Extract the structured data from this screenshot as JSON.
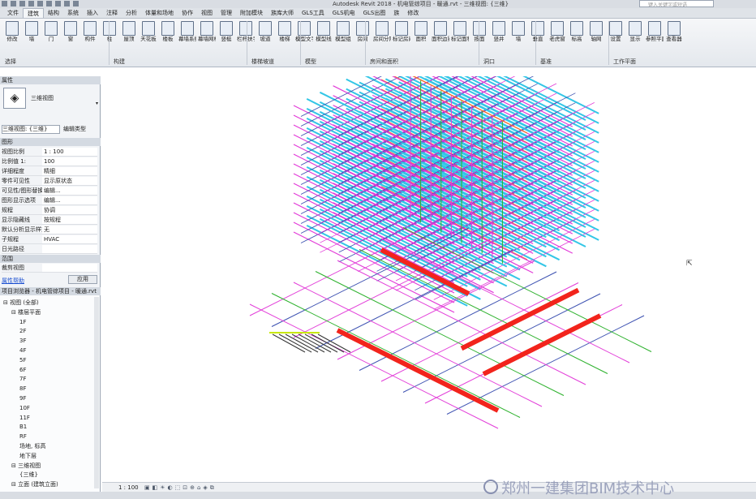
{
  "window": {
    "title": "Autodesk Revit 2018 -   机电管综项目 - 暖通.rvt - 三维视图: {三维}",
    "search_placeholder": "键入关键字或短语"
  },
  "tabs": [
    "文件",
    "建筑",
    "结构",
    "系统",
    "插入",
    "注释",
    "分析",
    "体量和场地",
    "协作",
    "视图",
    "管理",
    "附加模块",
    "族库大师",
    "GLS工具",
    "GLS机电",
    "GLS出图",
    "族",
    "修改"
  ],
  "active_tab": "建筑",
  "ribbon": {
    "tools": [
      "修改",
      "墙",
      "门",
      "窗",
      "构件",
      "柱",
      "屋顶",
      "天花板",
      "楼板",
      "幕墙系统",
      "幕墙网格",
      "竖梃",
      "栏杆扶手",
      "坡道",
      "楼梯",
      "模型文字",
      "模型线",
      "模型组",
      "房间",
      "房间分隔",
      "标记房间",
      "面积",
      "面积边界",
      "标记面积",
      "按面",
      "竖井",
      "墙",
      "垂直",
      "老虎窗",
      "标高",
      "轴网",
      "设置",
      "显示",
      "参照平面",
      "查看器"
    ],
    "panels": [
      "选择",
      "构建",
      "楼梯坡道",
      "模型",
      "房间和面积",
      "洞口",
      "基准",
      "工作平面"
    ]
  },
  "properties": {
    "header": "属性",
    "type_name": "三维视图",
    "selector": "三维视图: {三维}",
    "edit_type": "编辑类型",
    "section_graphics": "图形",
    "rows": [
      {
        "k": "视图比例",
        "v": "1 : 100"
      },
      {
        "k": "比例值 1:",
        "v": "100"
      },
      {
        "k": "详细程度",
        "v": "精细"
      },
      {
        "k": "零件可见性",
        "v": "显示原状态"
      },
      {
        "k": "可见性/图形替换",
        "v": "编辑..."
      },
      {
        "k": "图形显示选项",
        "v": "编辑..."
      },
      {
        "k": "规程",
        "v": "协调"
      },
      {
        "k": "显示隐藏线",
        "v": "按规程"
      },
      {
        "k": "默认分析显示样式",
        "v": "无"
      },
      {
        "k": "子规程",
        "v": "HVAC"
      },
      {
        "k": "日光路径",
        "v": ""
      }
    ],
    "section_extents": "范围",
    "crop_row": {
      "k": "裁剪视图",
      "v": ""
    },
    "help_link": "属性帮助",
    "apply": "应用"
  },
  "browser": {
    "header": "项目浏览器 - 机电管综项目 - 暖通.rvt",
    "items": [
      {
        "label": "视图 (全部)",
        "indent": 0
      },
      {
        "label": "楼层平面",
        "indent": 1
      },
      {
        "label": "1F",
        "indent": 2
      },
      {
        "label": "2F",
        "indent": 2
      },
      {
        "label": "3F",
        "indent": 2
      },
      {
        "label": "4F",
        "indent": 2
      },
      {
        "label": "5F",
        "indent": 2
      },
      {
        "label": "6F",
        "indent": 2
      },
      {
        "label": "7F",
        "indent": 2
      },
      {
        "label": "8F",
        "indent": 2
      },
      {
        "label": "9F",
        "indent": 2
      },
      {
        "label": "10F",
        "indent": 2
      },
      {
        "label": "11F",
        "indent": 2
      },
      {
        "label": "B1",
        "indent": 2
      },
      {
        "label": "RF",
        "indent": 2
      },
      {
        "label": "场地, 标高",
        "indent": 2
      },
      {
        "label": "地下层",
        "indent": 2
      },
      {
        "label": "三维视图",
        "indent": 1
      },
      {
        "label": "{三维}",
        "indent": 2
      },
      {
        "label": "立面 (建筑立面)",
        "indent": 1
      }
    ]
  },
  "status": {
    "scale": "1 : 100"
  },
  "watermark": "郑州一建集团BIM技术中心",
  "colors": {
    "cyan": "#33c6e6",
    "magenta": "#e23bd8",
    "red": "#f2241c",
    "orange": "#f07a1a",
    "green": "#2ab02a",
    "blue": "#3a4fb0",
    "lime": "#c8e800"
  }
}
